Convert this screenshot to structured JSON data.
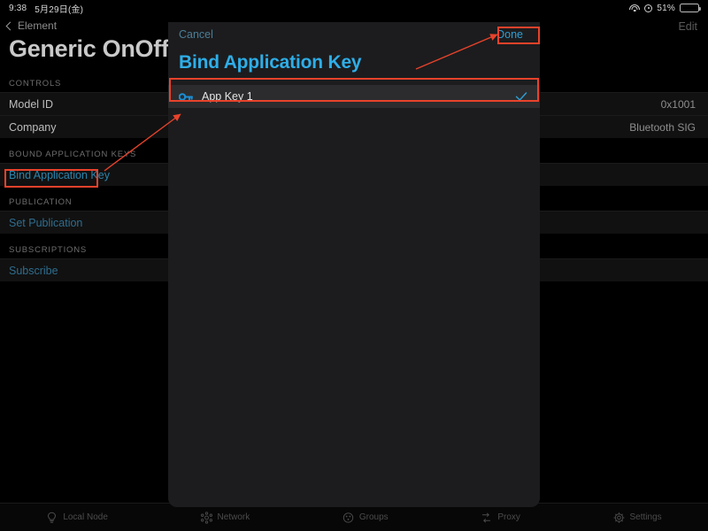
{
  "statusbar": {
    "time": "9:38",
    "date": "5月29日(金)",
    "battery_percent": "51%",
    "wifi_icon": "wifi-icon",
    "location_icon": "location-icon",
    "battery_icon": "battery-icon"
  },
  "navbar": {
    "back_label": "Element",
    "back_icon": "chevron-left-icon",
    "edit_label": "Edit",
    "page_title": "Generic OnOff Client"
  },
  "background_list": {
    "sections": [
      {
        "header": "CONTROLS",
        "rows": [
          {
            "label": "Model ID",
            "value": "0x1001",
            "type": "value"
          },
          {
            "label": "Company",
            "value": "Bluetooth SIG",
            "type": "value"
          }
        ]
      },
      {
        "header": "BOUND APPLICATION KEYS",
        "rows": [
          {
            "label": "Bind Application Key",
            "value": "",
            "type": "link-highlighted"
          }
        ]
      },
      {
        "header": "PUBLICATION",
        "rows": [
          {
            "label": "Set Publication",
            "value": "",
            "type": "link"
          }
        ]
      },
      {
        "header": "SUBSCRIPTIONS",
        "rows": [
          {
            "label": "Subscribe",
            "value": "",
            "type": "link"
          }
        ]
      }
    ]
  },
  "sheet": {
    "cancel_label": "Cancel",
    "done_label": "Done",
    "title": "Bind Application Key",
    "rows": [
      {
        "label": "App Key 1",
        "icon": "key-icon",
        "selected": true,
        "check_icon": "checkmark-icon"
      }
    ]
  },
  "tabbar": {
    "items": [
      {
        "label": "Local Node",
        "icon": "lightbulb-icon"
      },
      {
        "label": "Network",
        "icon": "mesh-network-icon"
      },
      {
        "label": "Groups",
        "icon": "groups-icon"
      },
      {
        "label": "Proxy",
        "icon": "proxy-icon"
      },
      {
        "label": "Settings",
        "icon": "gear-icon"
      }
    ]
  },
  "annotations": {
    "color": "#e8422b",
    "boxes": [
      "done-button",
      "app-key-row",
      "bind-application-key-row"
    ],
    "arrows": [
      "arrow-to-done-button",
      "arrow-to-app-key-row"
    ]
  }
}
